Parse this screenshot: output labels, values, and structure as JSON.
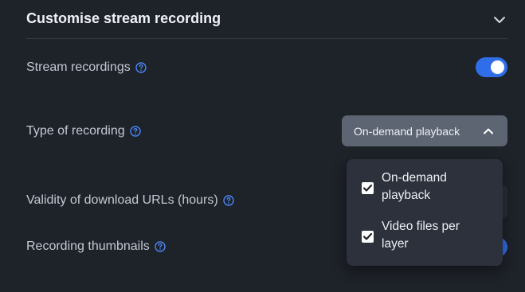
{
  "section": {
    "title": "Customise stream recording"
  },
  "rows": {
    "stream_recordings": {
      "label": "Stream recordings",
      "enabled": true
    },
    "type_of_recording": {
      "label": "Type of recording",
      "selected_value": "On-demand playback"
    },
    "validity": {
      "label": "Validity of download URLs (hours)"
    },
    "thumbnails": {
      "label": "Recording thumbnails"
    }
  },
  "dropdown": {
    "options": [
      {
        "label": "On-demand playback",
        "checked": true
      },
      {
        "label": "Video files per layer",
        "checked": true
      }
    ]
  },
  "colors": {
    "background": "#1e2229",
    "accent": "#2f6ee8",
    "select_bg": "#5d6573",
    "menu_bg": "#2c313b",
    "help_icon": "#4a86f7"
  },
  "icons": {
    "collapse": "chevron-down-icon",
    "select": "chevron-up-icon",
    "help": "help-circle-icon",
    "check": "check-icon"
  }
}
